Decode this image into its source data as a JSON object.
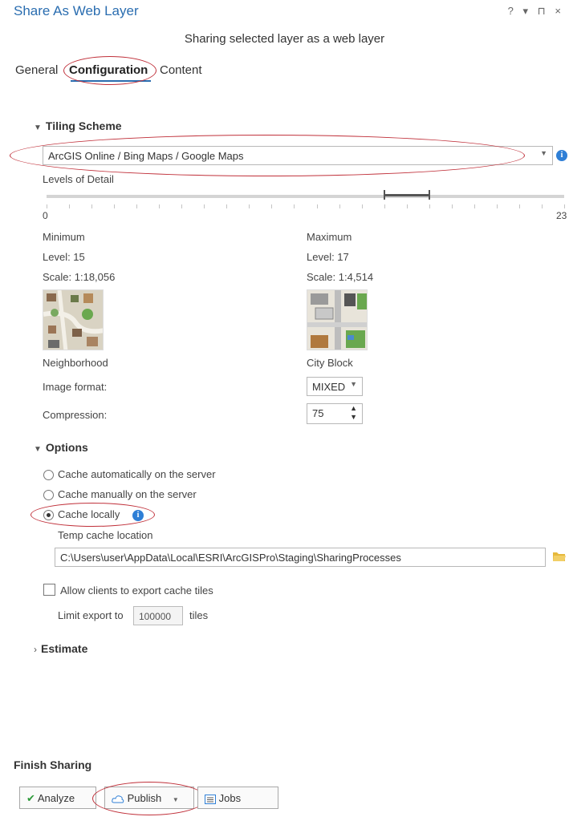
{
  "window": {
    "title": "Share As Web Layer",
    "controls": "? ▾ ⊓ ×"
  },
  "subtitle": "Sharing selected layer as a web layer",
  "tabs": [
    {
      "label": "General"
    },
    {
      "label": "Configuration",
      "active": true
    },
    {
      "label": "Content"
    }
  ],
  "tiling": {
    "section_label": "Tiling Scheme",
    "scheme_value": "ArcGIS Online / Bing Maps / Google Maps",
    "lod_label": "Levels of Detail",
    "slider_min": "0",
    "slider_max": "23",
    "range_min_level": 15,
    "range_max_level": 17
  },
  "minimum": {
    "header": "Minimum",
    "level": "Level:  15",
    "scale": "Scale:  1:18,056",
    "caption": "Neighborhood"
  },
  "maximum": {
    "header": "Maximum",
    "level": "Level:  17",
    "scale": "Scale:  1:4,514",
    "caption": "City Block"
  },
  "image_format": {
    "label": "Image format:",
    "value": "MIXED"
  },
  "compression": {
    "label": "Compression:",
    "value": "75"
  },
  "options": {
    "section_label": "Options",
    "radios": [
      {
        "label": "Cache automatically on the server",
        "selected": false
      },
      {
        "label": "Cache manually on the server",
        "selected": false
      },
      {
        "label": "Cache locally",
        "selected": true
      }
    ],
    "temp_label": "Temp cache location",
    "temp_path": "C:\\Users\\user\\AppData\\Local\\ESRI\\ArcGISPro\\Staging\\SharingProcesses",
    "allow_export_label": "Allow clients to export cache tiles",
    "limit_label": "Limit export to",
    "limit_value": "100000",
    "limit_unit": "tiles"
  },
  "estimate": {
    "section_label": "Estimate"
  },
  "finish": {
    "heading": "Finish Sharing",
    "analyze": "Analyze",
    "publish": "Publish",
    "jobs": "Jobs"
  },
  "colors": {
    "accent": "#2a6db0",
    "annotation": "#c0303a",
    "info": "#2f7fd6",
    "folder": "#e6b93c",
    "check": "#2e9a3a"
  }
}
